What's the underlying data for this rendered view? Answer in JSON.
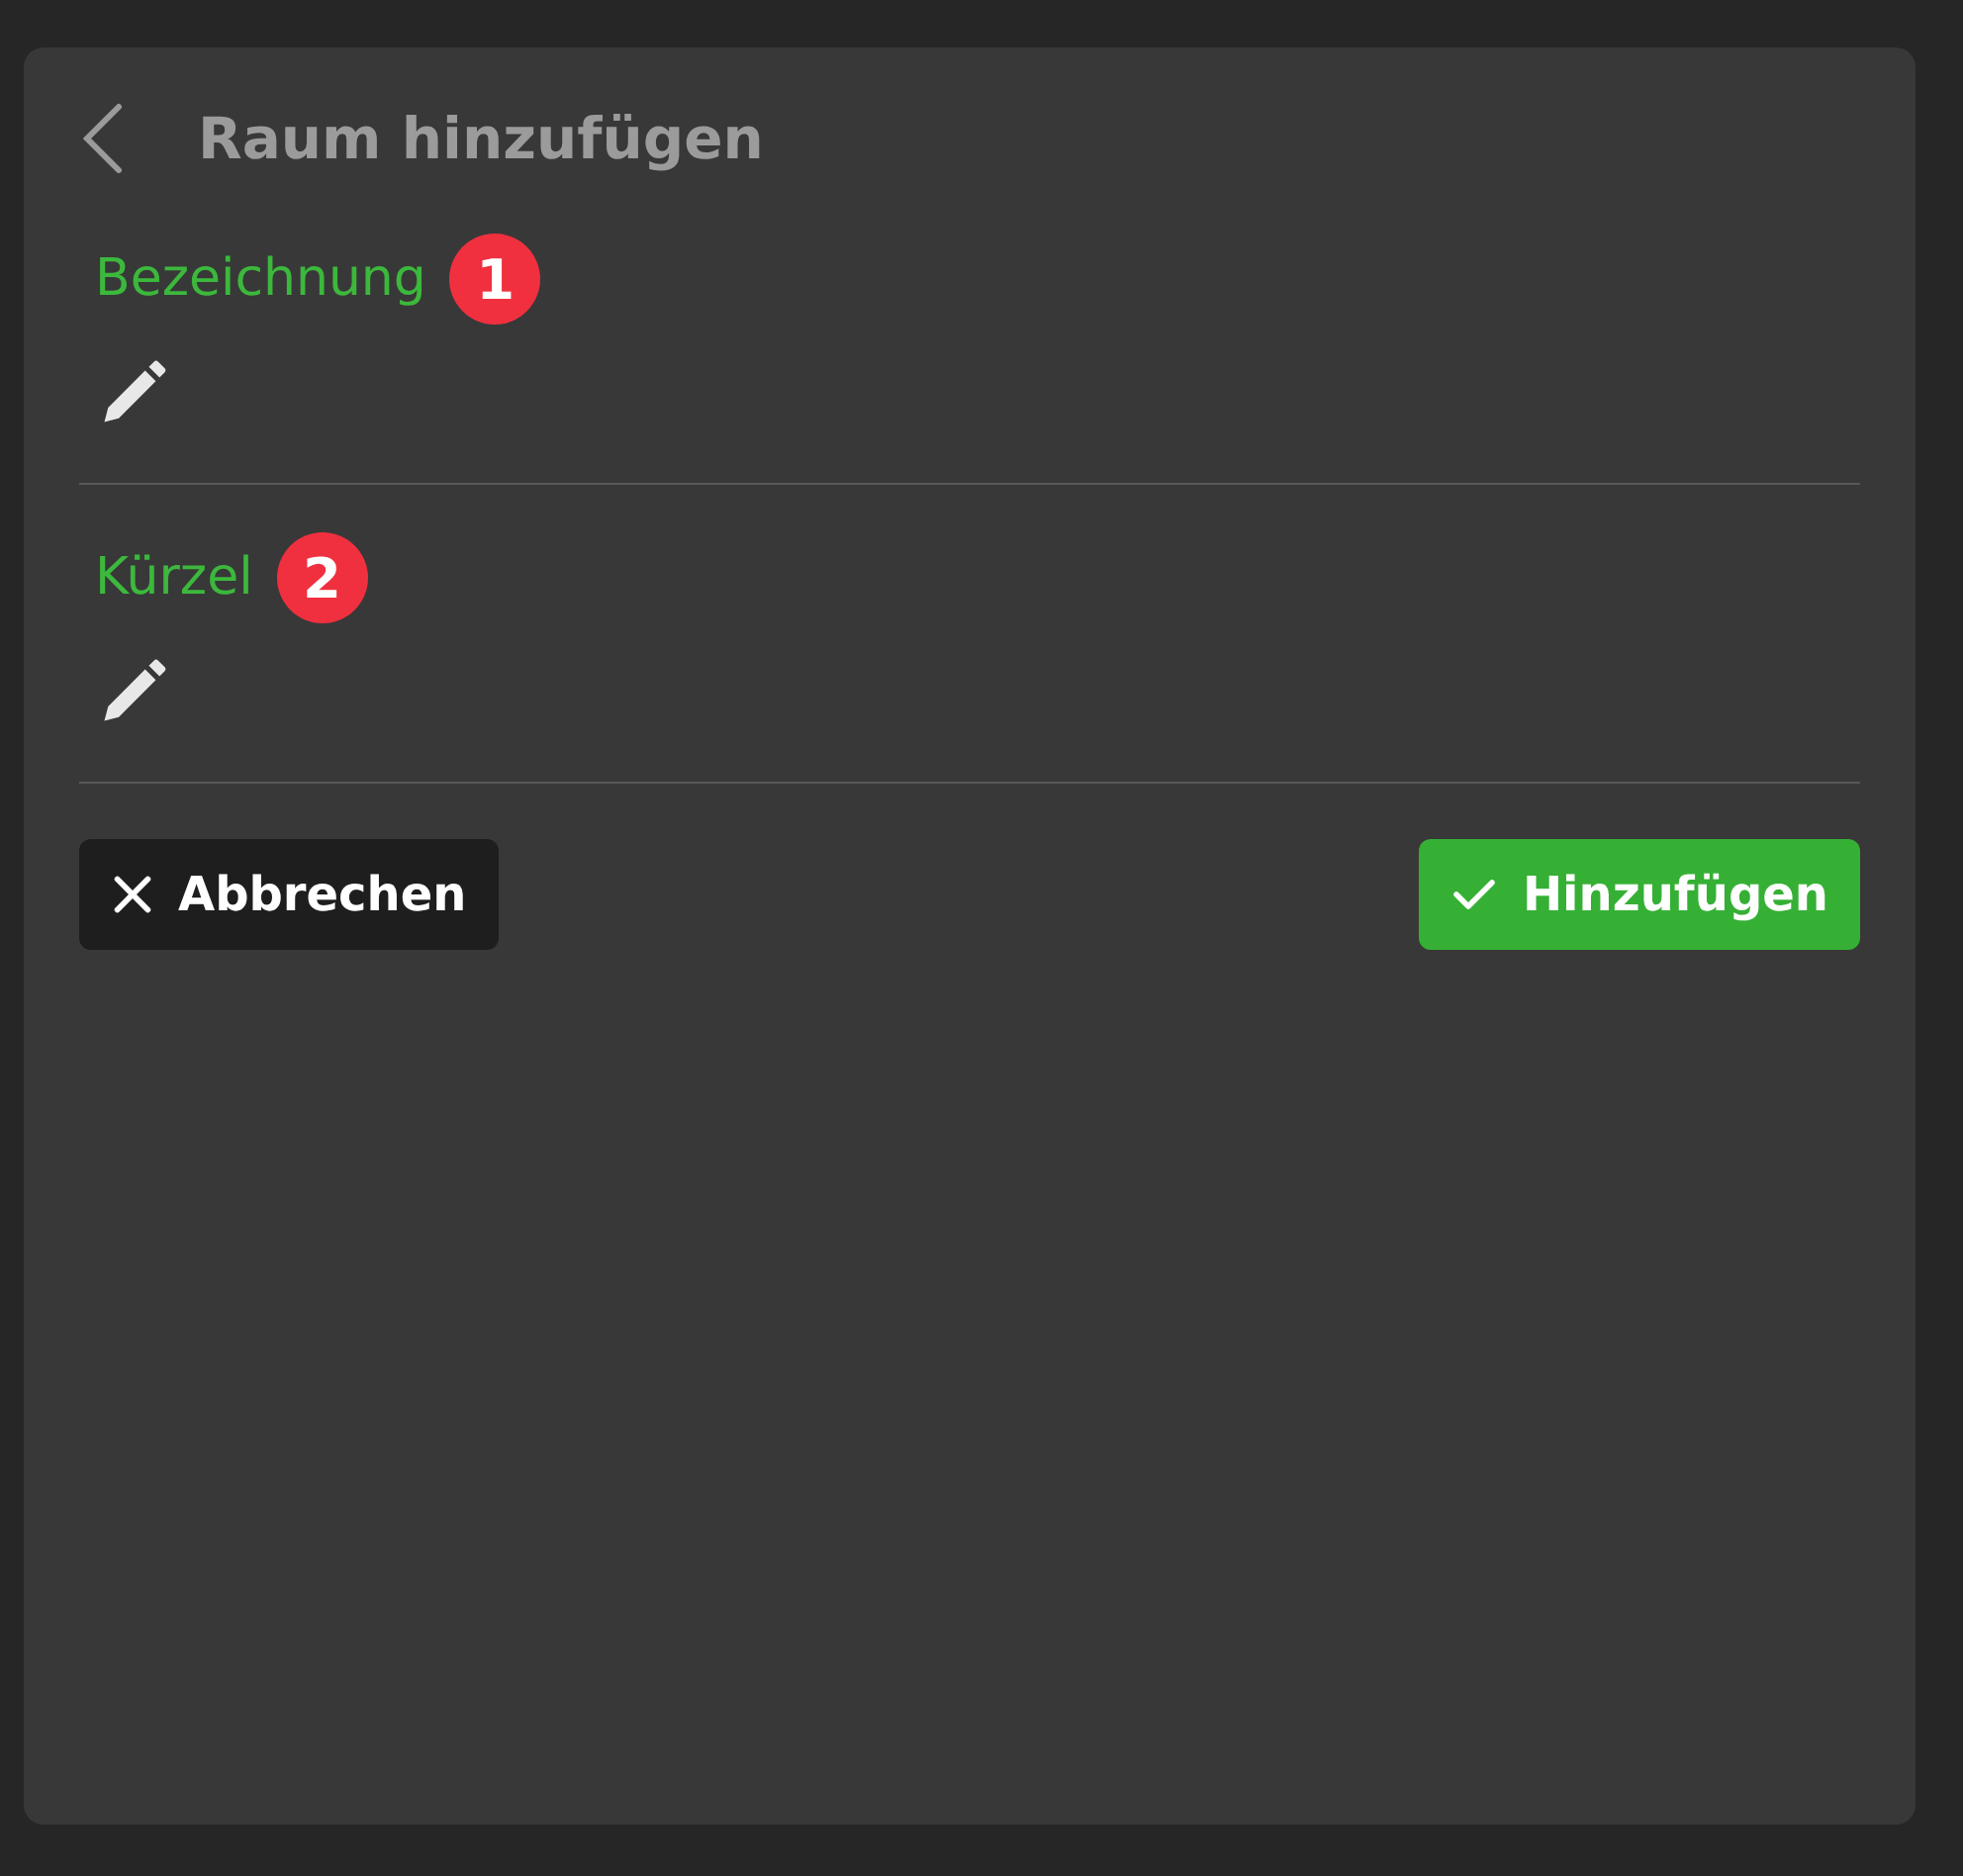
{
  "header": {
    "title": "Raum hinzufügen"
  },
  "fields": [
    {
      "label": "Bezeichnung",
      "marker": "1"
    },
    {
      "label": "Kürzel",
      "marker": "2"
    }
  ],
  "buttons": [
    {
      "label": "Abbrechen",
      "kind": "cancel"
    },
    {
      "label": "Hinzufügen",
      "kind": "confirm"
    }
  ]
}
